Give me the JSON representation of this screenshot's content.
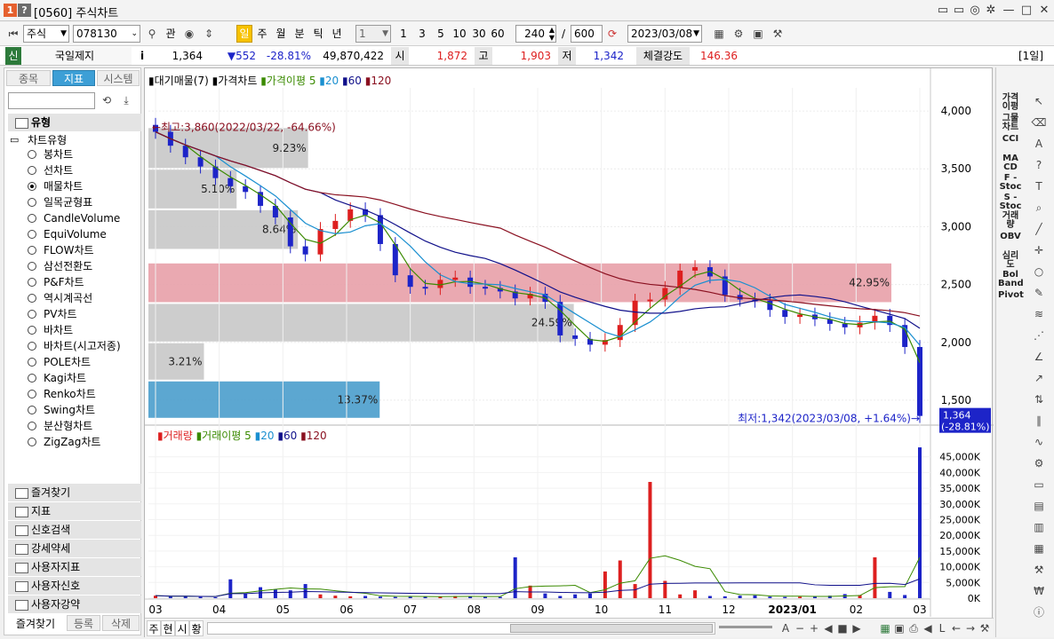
{
  "window": {
    "badge1": "1",
    "badge2": "?",
    "title": "[0560] 주식차트",
    "controls": [
      "▭",
      "▭",
      "◎",
      "✲",
      "—",
      "□",
      "✕"
    ]
  },
  "toolbar": {
    "market": "주식",
    "code": "078130",
    "btn_gwan": "관",
    "periods": [
      "일",
      "주",
      "월",
      "분",
      "틱",
      "년"
    ],
    "selected_period": "일",
    "interval_value": "1",
    "quick_intervals": [
      "1",
      "3",
      "5",
      "10",
      "30",
      "60"
    ],
    "count": "240",
    "slash": "/",
    "total": "600",
    "date": "2023/03/08"
  },
  "quote": {
    "tag": "신",
    "name": "국일제지",
    "info": "i",
    "price": "1,364",
    "change": "▼552",
    "change_pct": "-28.81%",
    "volume": "49,870,422",
    "open_label": "시",
    "open": "1,872",
    "high_label": "고",
    "high": "1,903",
    "low_label": "저",
    "low": "1,342",
    "strength_label": "체결강도",
    "strength": "146.36",
    "period_tag": "[1일]"
  },
  "left_panel": {
    "tabs": [
      "종목",
      "지표",
      "시스템"
    ],
    "active_tab": "지표",
    "section_title": "유형",
    "group_title": "차트유형",
    "chart_types": [
      "봉차트",
      "선차트",
      "매물차트",
      "일목균형표",
      "CandleVolume",
      "EquiVolume",
      "FLOW차트",
      "삼선전환도",
      "P&F차트",
      "역시계곡선",
      "PV차트",
      "바차트",
      "바차트(시고저종)",
      "POLE차트",
      "Kagi차트",
      "Renko차트",
      "Swing차트",
      "분산형차트",
      "ZigZag차트"
    ],
    "selected_type": "매물차트",
    "folders": [
      "즐겨찾기",
      "지표",
      "신호검색",
      "강세약세",
      "사용자지표",
      "사용자신호",
      "사용자강약"
    ],
    "bottom_tabs": [
      "즐겨찾기",
      "등록",
      "삭제"
    ]
  },
  "right_bar": {
    "labels": [
      "가격\n이평",
      "그물\n차트",
      "CCI",
      "MA\nCD",
      "F -\nStoc",
      "S -\nStoc",
      "거래\n량",
      "OBV",
      "심리\n도",
      "Bol\nBand",
      "Pivot"
    ],
    "icons": [
      "cursor-icon",
      "eraser-icon",
      "all-icon",
      "help-icon",
      "text-icon",
      "zoom-icon",
      "line-icon",
      "cross-icon",
      "circle-icon",
      "pencil-icon",
      "fibo-icon",
      "gann-icon",
      "angle-icon",
      "trend-icon",
      "channel-icon",
      "parallel-icon",
      "wave-icon",
      "auto-icon",
      "window-icon",
      "doc-icon",
      "chart-icon",
      "table-icon",
      "tool-icon",
      "price-icon",
      "info-icon"
    ]
  },
  "colors": {
    "accent_tab": "#3d9fd6",
    "period_on": "#f7c200",
    "up": "#dd1f1f",
    "down": "#1d24c8",
    "ma5": "#3a8a00",
    "ma20": "#1a8fd0",
    "ma60": "#10108a",
    "ma120": "#8a1020",
    "sell_zone": "#e8a0a8",
    "vp_bar": "#c8c8c8",
    "vp_current": "#4a9dcc"
  },
  "chart_data": [
    {
      "type": "candlestick",
      "legend": [
        "대기매물(7)",
        "가격차트",
        "가격이평",
        "5",
        "20",
        "60",
        "120"
      ],
      "y_ticks": [
        4000,
        3500,
        3000,
        2500,
        2000,
        1500
      ],
      "ylim": [
        1300,
        4200
      ],
      "x_ticks": [
        "03",
        "04",
        "05",
        "06",
        "07",
        "08",
        "09",
        "10",
        "11",
        "12",
        "2023/01",
        "02",
        "03"
      ],
      "annotations": {
        "max": "←최고:3,860(2022/03/22, -64.66%)",
        "min": "최저:1,342(2023/03/08, +1.64%)→",
        "last_price": "1,364",
        "last_pct": "(-28.81%)"
      },
      "close": [
        3820,
        3700,
        3600,
        3520,
        3420,
        3350,
        3300,
        3180,
        3080,
        2830,
        2760,
        2980,
        3050,
        3150,
        3100,
        2850,
        2580,
        2480,
        2470,
        2540,
        2560,
        2480,
        2470,
        2440,
        2380,
        2420,
        2350,
        2060,
        2030,
        1980,
        2020,
        2150,
        2360,
        2370,
        2470,
        2620,
        2650,
        2570,
        2410,
        2370,
        2360,
        2280,
        2220,
        2240,
        2200,
        2160,
        2130,
        2170,
        2230,
        2150,
        1960,
        1364
      ],
      "volume_profile": [
        {
          "range": [
            3500,
            3860
          ],
          "pct": "9.23%"
        },
        {
          "range": [
            3150,
            3500
          ],
          "pct": "5.10%"
        },
        {
          "range": [
            2800,
            3150
          ],
          "pct": "8.64%"
        },
        {
          "range": [
            2340,
            2690
          ],
          "pct": "42.95%"
        },
        {
          "range": [
            2000,
            2340
          ],
          "pct": "24.59%"
        },
        {
          "range": [
            1670,
            2000
          ],
          "pct": "3.21%"
        },
        {
          "range": [
            1340,
            1670
          ],
          "pct": "13.37%"
        }
      ]
    },
    {
      "type": "bar",
      "legend": [
        "거래량",
        "거래이평",
        "5",
        "20",
        "60",
        "120"
      ],
      "y_ticks": [
        "45,000K",
        "40,000K",
        "35,000K",
        "30,000K",
        "25,000K",
        "20,000K",
        "15,000K",
        "10,000K",
        "5,000K",
        "0K"
      ],
      "ylim": [
        0,
        50000
      ],
      "volume_k": [
        800,
        500,
        600,
        400,
        300,
        6000,
        1500,
        3500,
        2800,
        2500,
        4500,
        1200,
        800,
        600,
        700,
        500,
        400,
        600,
        500,
        500,
        700,
        600,
        400,
        400,
        13000,
        4000,
        1500,
        700,
        1200,
        1500,
        8500,
        12000,
        4500,
        37000,
        5500,
        1200,
        2500,
        700,
        600,
        800,
        900,
        500,
        400,
        500,
        600,
        800,
        1300,
        1000,
        13000,
        2000,
        1000,
        48000
      ]
    }
  ]
}
